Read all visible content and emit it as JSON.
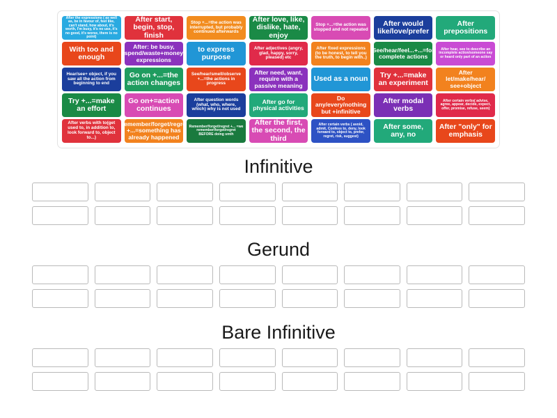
{
  "activity": {
    "type": "group-sort",
    "slot_columns": 8,
    "slot_rows_per_category": 2
  },
  "card_bank": {
    "rows": [
      [
        {
          "text": "After the expressions ( as well as, be in favour of, feel like, can't stand, how about, it's worth, I'm busy, it's no use, it's no good, it's worse, there is no point)",
          "color": "#29aae1",
          "size": "t-xs"
        },
        {
          "text": "After start, begin, stop, finish",
          "color": "#e0323c",
          "size": "t-lg"
        },
        {
          "text": "Stop +...=the action was interrupted, but probably continued afterwards",
          "color": "#f28c1e",
          "size": "t-sm"
        },
        {
          "text": "After love, like, dislike, hate, enjoy",
          "color": "#1a8a46",
          "size": "t-lg"
        },
        {
          "text": "Stop +...=the action was stopped and not repeated",
          "color": "#d84bb4",
          "size": "t-sm"
        },
        {
          "text": "After would like/love/prefer",
          "color": "#1b3e9c",
          "size": "t-lg"
        },
        {
          "text": "After prepositions",
          "color": "#22a97a",
          "size": "t-lg"
        }
      ],
      [
        {
          "text": "With too and enough",
          "color": "#e8471b",
          "size": "t-lg"
        },
        {
          "text": "After: be busy, spend/waste+money expressions",
          "color": "#8b32bd",
          "size": "t-md"
        },
        {
          "text": "to express purpose",
          "color": "#2196d6",
          "size": "t-lg"
        },
        {
          "text": "After adjectives (angry, glad, happy, sorry, pleased) etc",
          "color": "#e02a4a",
          "size": "t-sm"
        },
        {
          "text": "After fixed expressions (to be honest, to tell you the truth, to begin with..)",
          "color": "#f2821e",
          "size": "t-sm"
        },
        {
          "text": "See/hear/feel...+...=for complete actions",
          "color": "#1a8a46",
          "size": "t-md"
        },
        {
          "text": "After hear, see to describe an incomplete action/someone say or heard only part of an action",
          "color": "#c94bd4",
          "size": "t-xs"
        }
      ],
      [
        {
          "text": "Hear/see+ object, if you saw all the action from beginning to end",
          "color": "#1b3e9c",
          "size": "t-sm"
        },
        {
          "text": "Go on +...=the action changes",
          "color": "#1f9c5f",
          "size": "t-lg"
        },
        {
          "text": "See/hear/smell/observe +...=the actions in progress",
          "color": "#e8471b",
          "size": "t-sm"
        },
        {
          "text": "After need, want, require with a passive meaning",
          "color": "#8b32bd",
          "size": "t-md"
        },
        {
          "text": "Used as a noun",
          "color": "#2196d6",
          "size": "t-lg"
        },
        {
          "text": "Try +...=make an experiment",
          "color": "#e0323c",
          "size": "t-lg"
        },
        {
          "text": "After let/make/hear/ see+object",
          "color": "#f2821e",
          "size": "t-md"
        }
      ],
      [
        {
          "text": "Try +...=make an effort",
          "color": "#1a8a46",
          "size": "t-lg"
        },
        {
          "text": "Go on+=action continues",
          "color": "#d84bb4",
          "size": "t-lg"
        },
        {
          "text": "After question words (what, who, where, which) why is not used",
          "color": "#1b3e9c",
          "size": "t-sm"
        },
        {
          "text": "After go for physical activities",
          "color": "#22a97a",
          "size": "t-md"
        },
        {
          "text": "Do any/every/nothing but +infinitive",
          "color": "#e8471b",
          "size": "t-md"
        },
        {
          "text": "After modal verbs",
          "color": "#7b2fb5",
          "size": "t-lg"
        },
        {
          "text": "After certain verbs( advise, agree, appear, decide, expect, offer, promise, refuse, seem)",
          "color": "#e02a4a",
          "size": "t-xs"
        }
      ],
      [
        {
          "text": "After verbs with to(get used to, in addition to, look forward to, object to...)",
          "color": "#e0323c",
          "size": "t-sm"
        },
        {
          "text": "Remember/forget/regret +...=something has already happened",
          "color": "#f2821e",
          "size": "t-md"
        },
        {
          "text": "Remember/forget/regret +... =we remember/forget/regret BEFORE doing smth",
          "color": "#1a7a3e",
          "size": "t-xs"
        },
        {
          "text": "After the first, the second, the third",
          "color": "#d84bb4",
          "size": "t-lg"
        },
        {
          "text": "After certain verbs ( avoid, admit, Confess to, deny, look forward to, object to, prefer, regret, risk, suggest)",
          "color": "#2d52c4",
          "size": "t-xs"
        },
        {
          "text": "After some, any, no",
          "color": "#22a97a",
          "size": "t-lg"
        },
        {
          "text": "After \"only\" for emphasis",
          "color": "#e8471b",
          "size": "t-lg"
        }
      ]
    ]
  },
  "categories": [
    {
      "title": "Infinitive"
    },
    {
      "title": "Gerund"
    },
    {
      "title": "Bare Infinitive"
    }
  ]
}
